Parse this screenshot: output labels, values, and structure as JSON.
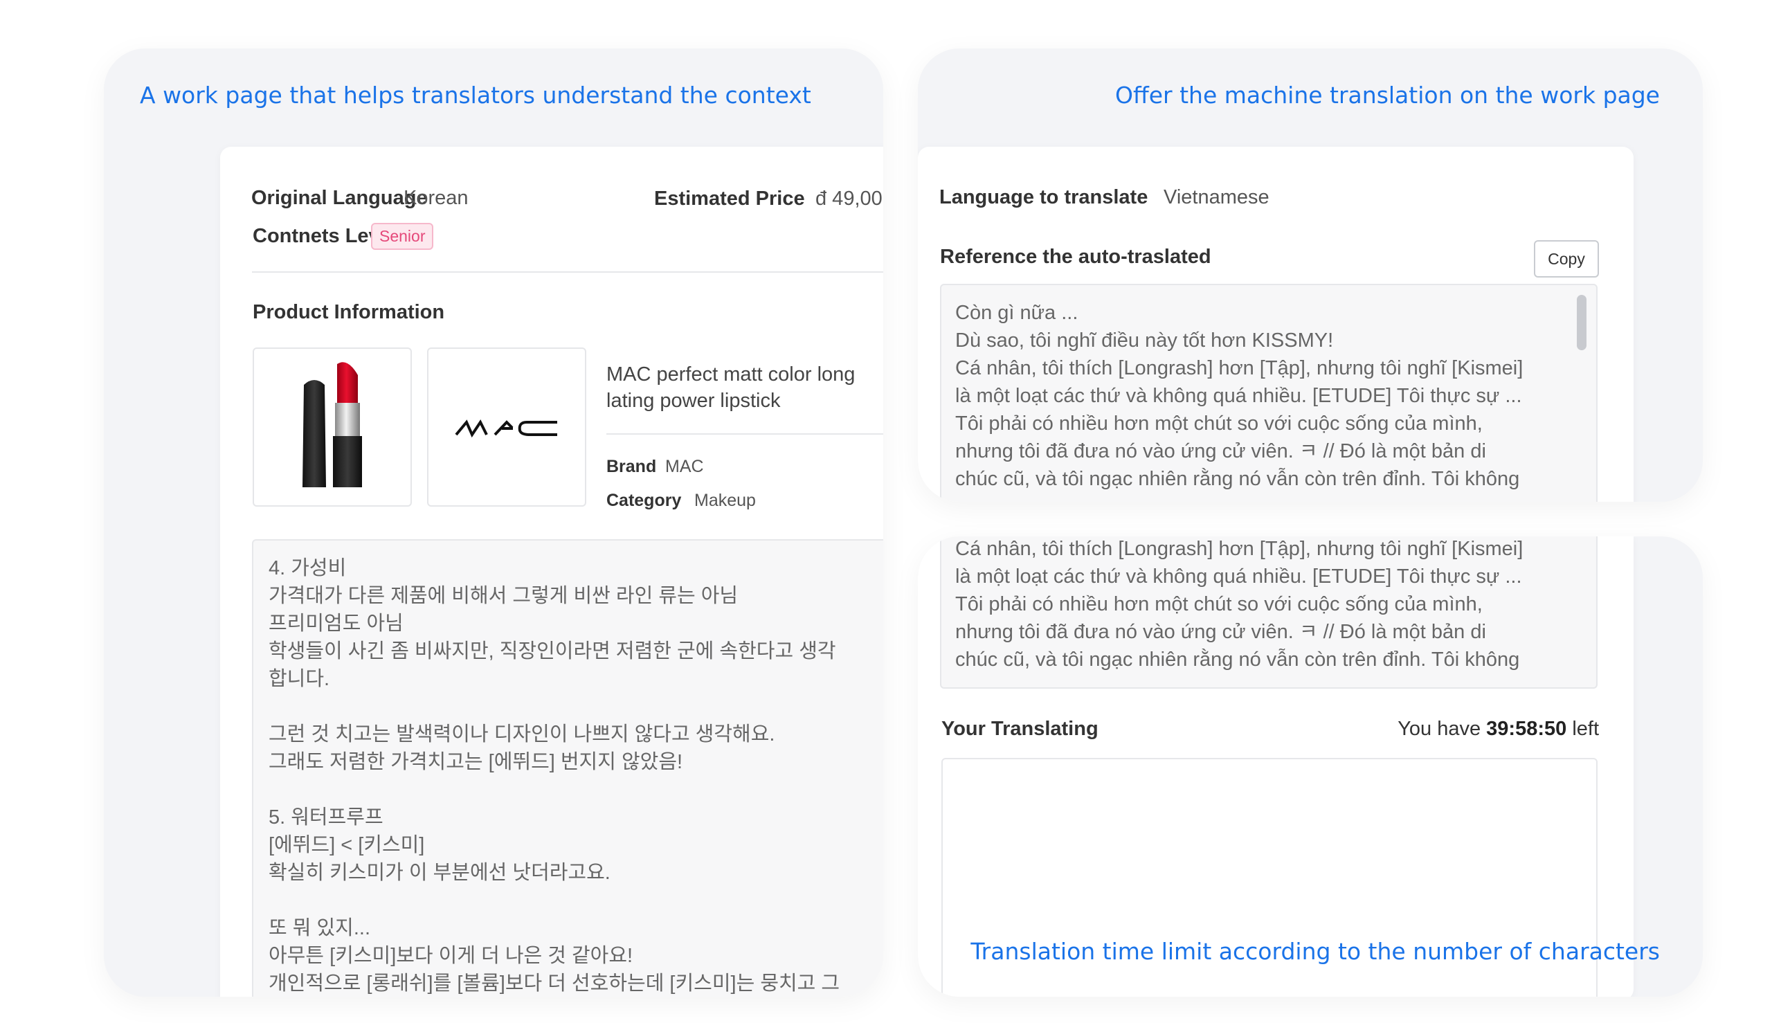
{
  "left_panel": {
    "caption": "A work page that helps translators understand the context",
    "original_language_label": "Original Language",
    "original_language_value": "Korean",
    "estimated_price_label": "Estimated Price",
    "estimated_price_value": "đ 49,00",
    "contents_level_label": "Contnets Level",
    "contents_level_badge": "Senior",
    "product_info_title": "Product Information",
    "product_name": "MAC perfect matt color long\nlating power lipstick",
    "brand_label": "Brand",
    "brand_value": "MAC",
    "category_label": "Category",
    "category_value": "Makeup",
    "logo_text": "MAC",
    "source_text": "4. 가성비\n가격대가 다른 제품에 비해서 그렇게 비싼 라인 류는 아님\n프리미엄도 아님\n학생들이 사긴 좀 비싸지만, 직장인이라면 저렴한 군에 속한다고 생각\n합니다.\n\n그런 것 치고는 발색력이나 디자인이 나쁘지 않다고 생각해요.\n그래도 저렴한 가격치고는 [에뛰드] 번지지 않았음!\n\n5. 워터프루프\n[에뛰드] < [키스미]\n확실히 키스미가 이 부분에선 낫더라고요.\n\n또 뭐 있지...\n아무튼 [키스미]보다 이게 더 나은 것 같아요!\n개인적으로 [롱래쉬]를 [볼륨]보다 더 선호하는데 [키스미]는 뭉치고 그"
  },
  "top_right_panel": {
    "caption": "Offer the machine translation on the work page",
    "language_label": "Language to translate",
    "language_value": "Vietnamese",
    "reference_title": "Reference the auto-traslated",
    "copy_button": "Copy",
    "auto_text": "Còn gì nữa ...\nDù sao, tôi nghĩ điều này tốt hơn KISSMY!\nCá nhân, tôi thích [Longrash] hơn [Tập], nhưng tôi nghĩ [Kismei]\nlà một loạt các thứ và không quá nhiều. [ETUDE] Tôi thực sự ...\nTôi phải có nhiều hơn một chút so với cuộc sống của mình,\nnhưng tôi đã đưa nó vào ứng cử viên. ㅋ // Đó là một bản di\nchúc cũ, và tôi ngạc nhiên rằng nó vẫn còn trên đỉnh. Tôi không"
  },
  "bottom_right_panel": {
    "auto_text_tail": "Cá nhân, tôi thích [Longrash] hơn [Tập], nhưng tôi nghĩ [Kismei]\nlà một loạt các thứ và không quá nhiều. [ETUDE] Tôi thực sự ...\nTôi phải có nhiều hơn một chút so với cuộc sống của mình,\nnhưng tôi đã đưa nó vào ứng cử viên. ㅋ // Đó là một bản di\nchúc cũ, và tôi ngạc nhiên rằng nó vẫn còn trên đỉnh. Tôi không",
    "your_translating_label": "Your Translating",
    "time_prefix": "You have",
    "time_value": "39:58:50",
    "time_suffix": "left",
    "caption": "Translation time limit according to the number of characters"
  },
  "colors": {
    "caption": "#1a73e8",
    "badge_text": "#e5497a",
    "panel_bg": "#f3f4f7"
  }
}
